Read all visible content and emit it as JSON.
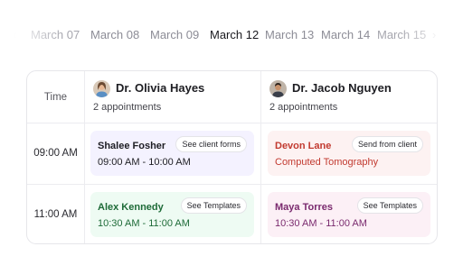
{
  "dates": [
    "March 07",
    "March 08",
    "March 09",
    "March 12",
    "March 13",
    "March 14",
    "March 15"
  ],
  "time_header": "Time",
  "time_slots": [
    "09:00 AM",
    "11:00 AM"
  ],
  "doctors": [
    {
      "name": "Dr. Olivia Hayes",
      "count": "2 appointments",
      "avatar_icon": "woman-avatar"
    },
    {
      "name": "Dr. Jacob Nguyen",
      "count": "2 appointments",
      "avatar_icon": "man-avatar"
    }
  ],
  "appointments": [
    {
      "title": "Shalee Fosher",
      "subtitle": "09:00 AM - 10:00 AM",
      "action": "See client forms",
      "color": "#f4f2ff",
      "text_color": "#1d1d22"
    },
    {
      "title": "Devon Lane",
      "subtitle": "Computed Tomography",
      "action": "Send from client",
      "color": "#fdf2f2",
      "text_color": "#c23a30"
    },
    {
      "title": "Alex Kennedy",
      "subtitle": "10:30 AM - 11:00 AM",
      "action": "See Templates",
      "color": "#eefbf3",
      "text_color": "#1e6b38"
    },
    {
      "title": "Maya Torres",
      "subtitle": "10:30 AM - 11:00 AM",
      "action": "See Templates",
      "color": "#fcf0f6",
      "text_color": "#7a2a6e"
    }
  ],
  "colors": {
    "active_date": "#1a1a1f",
    "inactive_date": "#8c8c96",
    "border": "#e6e6ea"
  }
}
